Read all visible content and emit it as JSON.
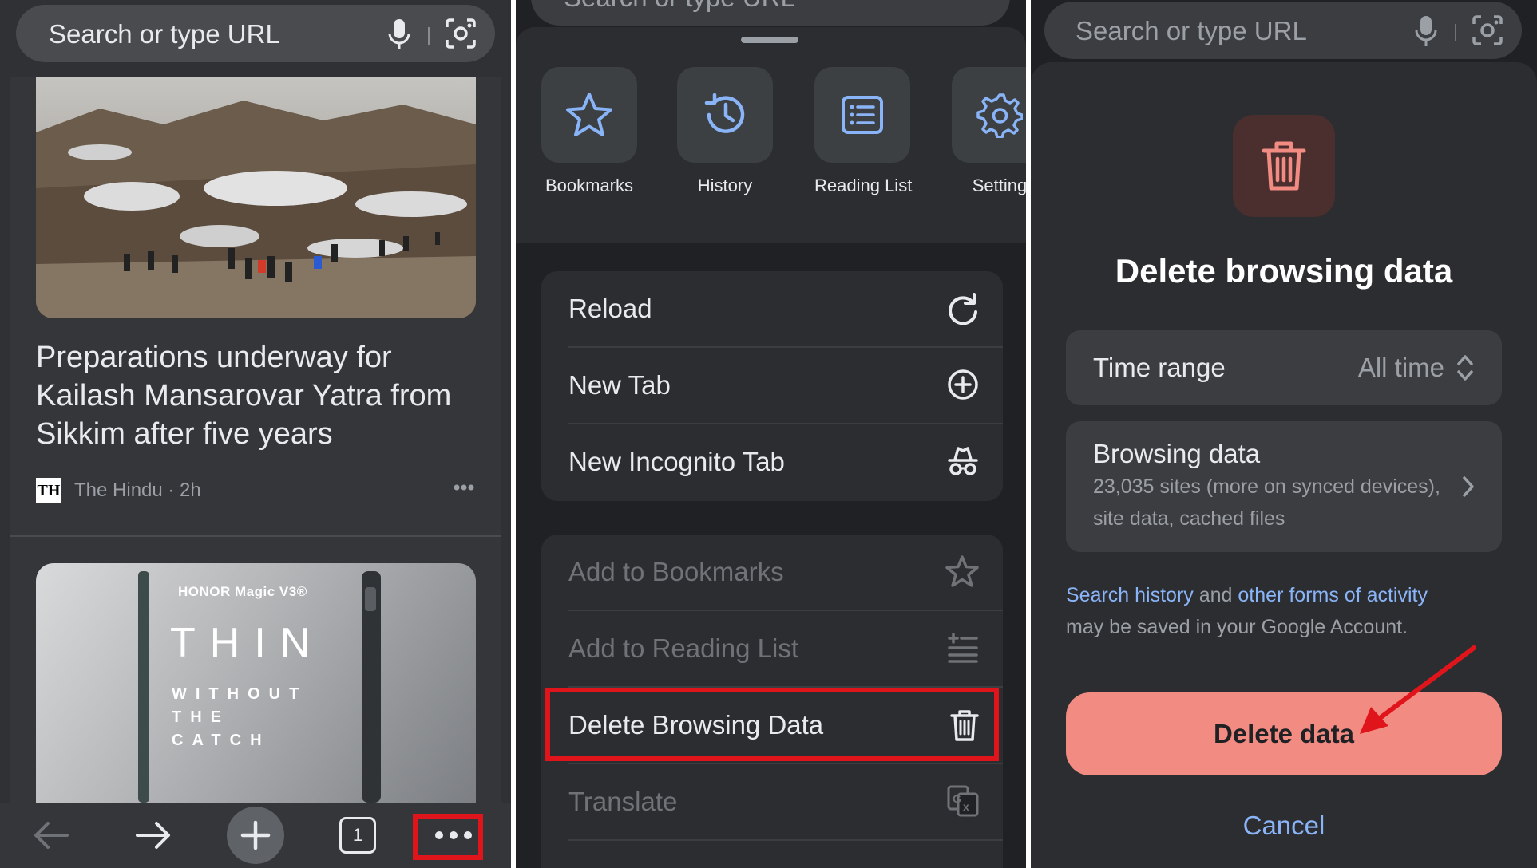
{
  "panel1": {
    "url_placeholder": "Search or type URL",
    "article": {
      "headline": "Preparations underway for Kailash Mansarovar Yatra from Sikkim after five years",
      "source_logo": "TH",
      "source": "The Hindu · 2h"
    },
    "ad": {
      "brand": "HONOR Magic V3®",
      "big": "THIN",
      "line1": "WITHOUT",
      "line2": "THE",
      "line3": "CATCH"
    },
    "toolbar": {
      "tab_count": "1",
      "icons": [
        "back-arrow-icon",
        "forward-arrow-icon",
        "new-tab-plus-icon",
        "tab-switcher-icon",
        "more-menu-icon"
      ]
    }
  },
  "panel2": {
    "ghost_url": "Search or type URL",
    "shortcuts": [
      {
        "label": "Bookmarks",
        "icon": "star-icon"
      },
      {
        "label": "History",
        "icon": "history-icon"
      },
      {
        "label": "Reading List",
        "icon": "reading-list-icon"
      },
      {
        "label": "Setting",
        "icon": "gear-icon"
      }
    ],
    "menu_group1": [
      {
        "label": "Reload",
        "icon": "reload-icon"
      },
      {
        "label": "New Tab",
        "icon": "plus-circle-icon"
      },
      {
        "label": "New Incognito Tab",
        "icon": "incognito-icon"
      }
    ],
    "menu_group2": [
      {
        "label": "Add to Bookmarks",
        "icon": "star-icon",
        "disabled": true
      },
      {
        "label": "Add to Reading List",
        "icon": "add-reading-list-icon",
        "disabled": true
      },
      {
        "label": "Delete Browsing Data",
        "icon": "trash-icon",
        "highlighted": true
      },
      {
        "label": "Translate",
        "icon": "translate-icon",
        "disabled": true
      }
    ]
  },
  "panel3": {
    "url_placeholder": "Search or type URL",
    "title": "Delete browsing data",
    "time_range_label": "Time range",
    "time_range_value": "All time",
    "browsing_data_label": "Browsing data",
    "browsing_data_detail": "23,035 sites (more on synced devices), site data, cached files",
    "note_link1": "Search history",
    "note_and": " and ",
    "note_link2": "other forms of activity",
    "note_rest": "may be saved in your Google Account.",
    "delete_label": "Delete data",
    "cancel_label": "Cancel"
  },
  "colors": {
    "highlight_red": "#e0151c",
    "delete_button": "#f28b82",
    "link_blue": "#8ab4f8",
    "icon_blue": "#8ab4f8"
  }
}
